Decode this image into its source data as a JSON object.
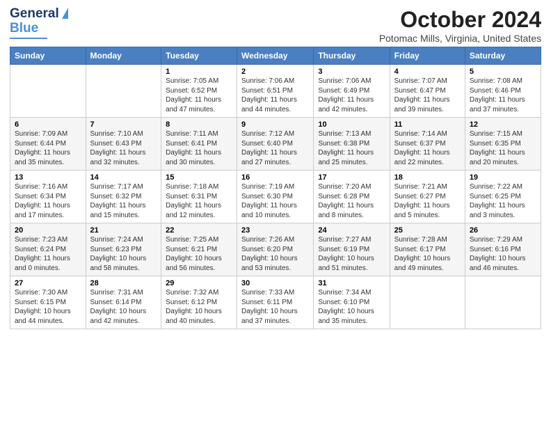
{
  "header": {
    "logo_line1": "General",
    "logo_line2": "Blue",
    "title": "October 2024",
    "subtitle": "Potomac Mills, Virginia, United States"
  },
  "days_of_week": [
    "Sunday",
    "Monday",
    "Tuesday",
    "Wednesday",
    "Thursday",
    "Friday",
    "Saturday"
  ],
  "weeks": [
    [
      {
        "day": "",
        "info": ""
      },
      {
        "day": "",
        "info": ""
      },
      {
        "day": "1",
        "info": "Sunrise: 7:05 AM\nSunset: 6:52 PM\nDaylight: 11 hours and 47 minutes."
      },
      {
        "day": "2",
        "info": "Sunrise: 7:06 AM\nSunset: 6:51 PM\nDaylight: 11 hours and 44 minutes."
      },
      {
        "day": "3",
        "info": "Sunrise: 7:06 AM\nSunset: 6:49 PM\nDaylight: 11 hours and 42 minutes."
      },
      {
        "day": "4",
        "info": "Sunrise: 7:07 AM\nSunset: 6:47 PM\nDaylight: 11 hours and 39 minutes."
      },
      {
        "day": "5",
        "info": "Sunrise: 7:08 AM\nSunset: 6:46 PM\nDaylight: 11 hours and 37 minutes."
      }
    ],
    [
      {
        "day": "6",
        "info": "Sunrise: 7:09 AM\nSunset: 6:44 PM\nDaylight: 11 hours and 35 minutes."
      },
      {
        "day": "7",
        "info": "Sunrise: 7:10 AM\nSunset: 6:43 PM\nDaylight: 11 hours and 32 minutes."
      },
      {
        "day": "8",
        "info": "Sunrise: 7:11 AM\nSunset: 6:41 PM\nDaylight: 11 hours and 30 minutes."
      },
      {
        "day": "9",
        "info": "Sunrise: 7:12 AM\nSunset: 6:40 PM\nDaylight: 11 hours and 27 minutes."
      },
      {
        "day": "10",
        "info": "Sunrise: 7:13 AM\nSunset: 6:38 PM\nDaylight: 11 hours and 25 minutes."
      },
      {
        "day": "11",
        "info": "Sunrise: 7:14 AM\nSunset: 6:37 PM\nDaylight: 11 hours and 22 minutes."
      },
      {
        "day": "12",
        "info": "Sunrise: 7:15 AM\nSunset: 6:35 PM\nDaylight: 11 hours and 20 minutes."
      }
    ],
    [
      {
        "day": "13",
        "info": "Sunrise: 7:16 AM\nSunset: 6:34 PM\nDaylight: 11 hours and 17 minutes."
      },
      {
        "day": "14",
        "info": "Sunrise: 7:17 AM\nSunset: 6:32 PM\nDaylight: 11 hours and 15 minutes."
      },
      {
        "day": "15",
        "info": "Sunrise: 7:18 AM\nSunset: 6:31 PM\nDaylight: 11 hours and 12 minutes."
      },
      {
        "day": "16",
        "info": "Sunrise: 7:19 AM\nSunset: 6:30 PM\nDaylight: 11 hours and 10 minutes."
      },
      {
        "day": "17",
        "info": "Sunrise: 7:20 AM\nSunset: 6:28 PM\nDaylight: 11 hours and 8 minutes."
      },
      {
        "day": "18",
        "info": "Sunrise: 7:21 AM\nSunset: 6:27 PM\nDaylight: 11 hours and 5 minutes."
      },
      {
        "day": "19",
        "info": "Sunrise: 7:22 AM\nSunset: 6:25 PM\nDaylight: 11 hours and 3 minutes."
      }
    ],
    [
      {
        "day": "20",
        "info": "Sunrise: 7:23 AM\nSunset: 6:24 PM\nDaylight: 11 hours and 0 minutes."
      },
      {
        "day": "21",
        "info": "Sunrise: 7:24 AM\nSunset: 6:23 PM\nDaylight: 10 hours and 58 minutes."
      },
      {
        "day": "22",
        "info": "Sunrise: 7:25 AM\nSunset: 6:21 PM\nDaylight: 10 hours and 56 minutes."
      },
      {
        "day": "23",
        "info": "Sunrise: 7:26 AM\nSunset: 6:20 PM\nDaylight: 10 hours and 53 minutes."
      },
      {
        "day": "24",
        "info": "Sunrise: 7:27 AM\nSunset: 6:19 PM\nDaylight: 10 hours and 51 minutes."
      },
      {
        "day": "25",
        "info": "Sunrise: 7:28 AM\nSunset: 6:17 PM\nDaylight: 10 hours and 49 minutes."
      },
      {
        "day": "26",
        "info": "Sunrise: 7:29 AM\nSunset: 6:16 PM\nDaylight: 10 hours and 46 minutes."
      }
    ],
    [
      {
        "day": "27",
        "info": "Sunrise: 7:30 AM\nSunset: 6:15 PM\nDaylight: 10 hours and 44 minutes."
      },
      {
        "day": "28",
        "info": "Sunrise: 7:31 AM\nSunset: 6:14 PM\nDaylight: 10 hours and 42 minutes."
      },
      {
        "day": "29",
        "info": "Sunrise: 7:32 AM\nSunset: 6:12 PM\nDaylight: 10 hours and 40 minutes."
      },
      {
        "day": "30",
        "info": "Sunrise: 7:33 AM\nSunset: 6:11 PM\nDaylight: 10 hours and 37 minutes."
      },
      {
        "day": "31",
        "info": "Sunrise: 7:34 AM\nSunset: 6:10 PM\nDaylight: 10 hours and 35 minutes."
      },
      {
        "day": "",
        "info": ""
      },
      {
        "day": "",
        "info": ""
      }
    ]
  ]
}
